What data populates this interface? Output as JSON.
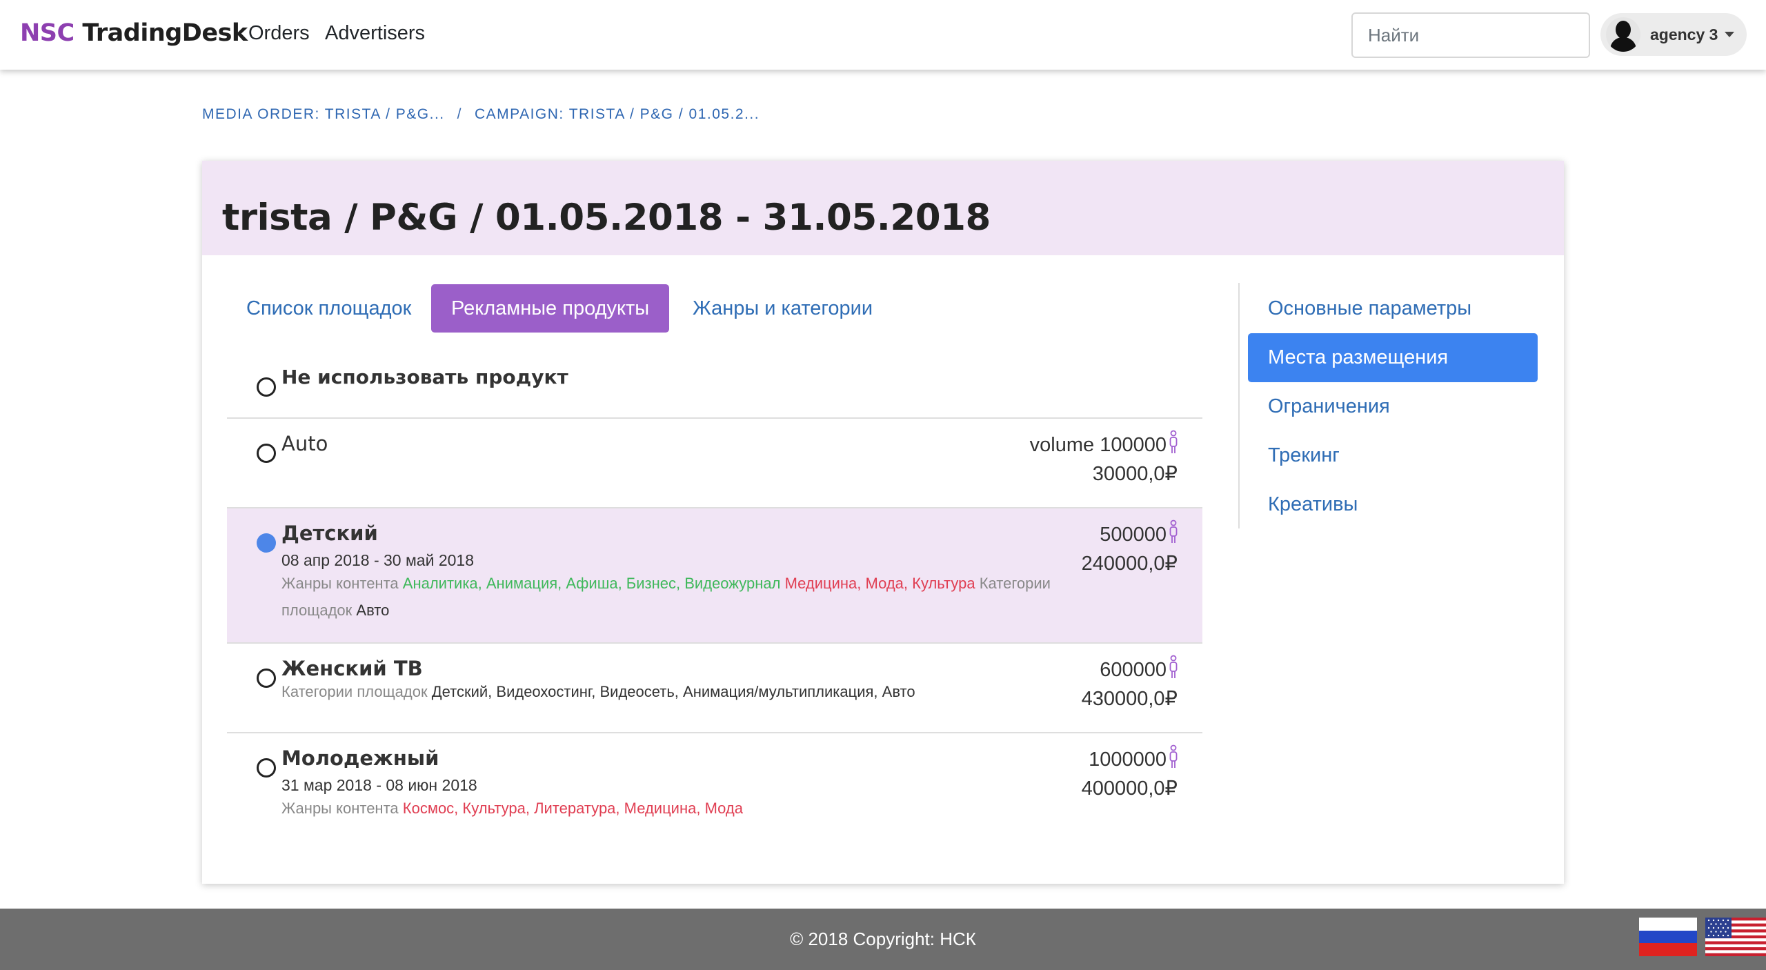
{
  "brand": {
    "part1": "NSC",
    "part2": "TradingDesk"
  },
  "nav": {
    "orders": "Orders",
    "advertisers": "Advertisers"
  },
  "search": {
    "placeholder": "Найти",
    "value": ""
  },
  "user": {
    "name": "agency 3"
  },
  "breadcrumb": {
    "media_order": "MEDIA ORDER: TRISTA / P&G...",
    "separator": "/",
    "campaign": "CAMPAIGN: TRISTA / P&G / 01.05.2..."
  },
  "title": "trista / P&G / 01.05.2018 - 31.05.2018",
  "tabs": [
    {
      "label": "Список площадок",
      "active": false
    },
    {
      "label": "Рекламные продукты",
      "active": true
    },
    {
      "label": "Жанры и категории",
      "active": false
    }
  ],
  "products": {
    "none": {
      "label": "Не использовать продукт",
      "selected": false
    },
    "auto": {
      "name": "Auto",
      "volume_label": "volume",
      "volume": "100000",
      "price": "30000,0₽",
      "selected": false
    },
    "kids": {
      "name": "Детский",
      "dates": "08 апр 2018 - 30 май 2018",
      "genres_label": "Жанры контента",
      "genres_included": "Аналитика, Анимация, Афиша, Бизнес, Видеожурнал",
      "genres_excluded": "Медицина, Мода, Культура",
      "categories_label": "Категории площадок",
      "categories": "Авто",
      "volume": "500000",
      "price": "240000,0₽",
      "selected": true
    },
    "women": {
      "name": "Женский ТВ",
      "categories_label": "Категории площадок",
      "categories": "Детский, Видеохостинг, Видеосеть, Анимация/мультипликация, Авто",
      "volume": "600000",
      "price": "430000,0₽",
      "selected": false
    },
    "youth": {
      "name": "Молодежный",
      "dates": "31 мар 2018 - 08 июн 2018",
      "genres_label": "Жанры контента",
      "genres_excluded": "Космос, Культура, Литература, Медицина, Мода",
      "volume": "1000000",
      "price": "400000,0₽",
      "selected": false
    }
  },
  "side_nav": [
    {
      "label": "Основные параметры",
      "active": false
    },
    {
      "label": "Места размещения",
      "active": true
    },
    {
      "label": "Ограничения",
      "active": false
    },
    {
      "label": "Трекинг",
      "active": false
    },
    {
      "label": "Креативы",
      "active": false
    }
  ],
  "footer": {
    "copyright": "© 2018 Copyright: НСК"
  },
  "flags": {
    "ru": "russian-flag-icon",
    "us": "us-flag-icon"
  },
  "colors": {
    "brand_purple": "#8d3fb0",
    "tab_active": "#9b5fc9",
    "side_active": "#3c83f0",
    "genre_included": "#3fb85b",
    "genre_excluded": "#e03e52",
    "header_bg": "#f1e5f5",
    "footer_bg": "#6e6e6e"
  }
}
